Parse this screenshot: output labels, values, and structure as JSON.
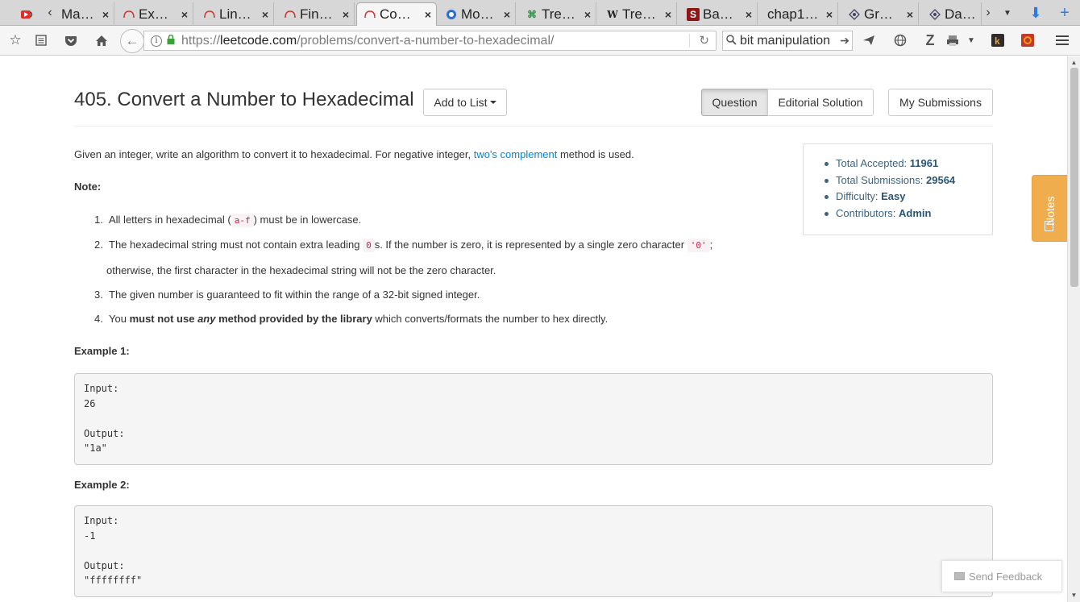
{
  "browser": {
    "tabs": [
      {
        "title": "Ma…",
        "favicon": "youtube-audio-icon"
      },
      {
        "title": "Ex…",
        "favicon": "leetcode-icon"
      },
      {
        "title": "Lin…",
        "favicon": "leetcode-icon"
      },
      {
        "title": "Fin…",
        "favicon": "leetcode-icon"
      },
      {
        "title": "Co…",
        "favicon": "leetcode-icon",
        "active": true
      },
      {
        "title": "Mo…",
        "favicon": "globe-icon"
      },
      {
        "title": "Tre…",
        "favicon": "geeks-icon"
      },
      {
        "title": "Tre…",
        "favicon": "wikipedia-icon"
      },
      {
        "title": "Ba…",
        "favicon": "stanford-icon"
      },
      {
        "title": "chap1…",
        "favicon": ""
      },
      {
        "title": "Gr…",
        "favicon": "diamond-icon"
      },
      {
        "title": "Da…",
        "favicon": "diamond-icon"
      }
    ],
    "url_prefix": "https://",
    "url_domain": "leetcode.com",
    "url_path": "/problems/convert-a-number-to-hexadecimal/",
    "search_query": "bit manipulation"
  },
  "problem": {
    "title": "405. Convert a Number to Hexadecimal",
    "add_to_list": "Add to List",
    "tab_question": "Question",
    "tab_editorial": "Editorial Solution",
    "my_submissions": "My Submissions",
    "intro_before": "Given an integer, write an algorithm to convert it to hexadecimal. For negative integer, ",
    "intro_link": "two's complement",
    "intro_after": " method is used.",
    "note_heading": "Note:",
    "notes": {
      "n1_num": "1.",
      "n1_a": "All letters in hexadecimal (",
      "n1_code": "a-f",
      "n1_b": ") must be in lowercase.",
      "n2_num": "2.",
      "n2_a": "The hexadecimal string must not contain extra leading ",
      "n2_code1": "0",
      "n2_b": "s. If the number is zero, it is represented by a single zero character ",
      "n2_code2": "'0'",
      "n2_c": ";",
      "n2_line2": "otherwise, the first character in the hexadecimal string will not be the zero character.",
      "n3_num": "3.",
      "n3": "The given number is guaranteed to fit within the range of a 32-bit signed integer.",
      "n4_num": "4.",
      "n4_a": "You ",
      "n4_b1": "must not use ",
      "n4_em": "any",
      "n4_b2": " method provided by the library",
      "n4_c": " which converts/formats the number to hex directly."
    },
    "example1_heading": "Example 1:",
    "example1": "Input:\n26\n\nOutput:\n\"1a\"",
    "example2_heading": "Example 2:",
    "example2": "Input:\n-1\n\nOutput:\n\"ffffffff\"",
    "stats": {
      "accepted_label": "Total Accepted: ",
      "accepted": "11961",
      "submissions_label": "Total Submissions: ",
      "submissions": "29564",
      "difficulty_label": "Difficulty: ",
      "difficulty": "Easy",
      "contributors_label": "Contributors: ",
      "contributors": "Admin"
    },
    "notes_tab": "Notes",
    "feedback": "Send Feedback"
  }
}
